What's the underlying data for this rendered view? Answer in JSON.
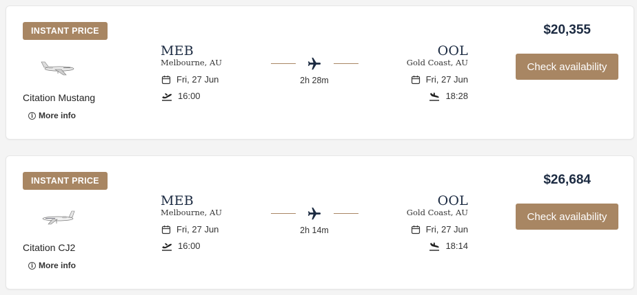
{
  "colors": {
    "accent": "#a88663",
    "text": "#1b2a41",
    "card_bg": "#ffffff"
  },
  "flights": [
    {
      "badge": "INSTANT PRICE",
      "aircraft": "Citation Mustang",
      "more_info": "More info",
      "departure": {
        "code": "MEB",
        "city": "Melbourne, AU",
        "date": "Fri, 27 Jun",
        "time": "16:00"
      },
      "duration": "2h 28m",
      "arrival": {
        "code": "OOL",
        "city": "Gold Coast, AU",
        "date": "Fri, 27 Jun",
        "time": "18:28"
      },
      "price": "$20,355",
      "cta": "Check availability"
    },
    {
      "badge": "INSTANT PRICE",
      "aircraft": "Citation CJ2",
      "more_info": "More info",
      "departure": {
        "code": "MEB",
        "city": "Melbourne, AU",
        "date": "Fri, 27 Jun",
        "time": "16:00"
      },
      "duration": "2h 14m",
      "arrival": {
        "code": "OOL",
        "city": "Gold Coast, AU",
        "date": "Fri, 27 Jun",
        "time": "18:14"
      },
      "price": "$26,684",
      "cta": "Check availability"
    }
  ]
}
